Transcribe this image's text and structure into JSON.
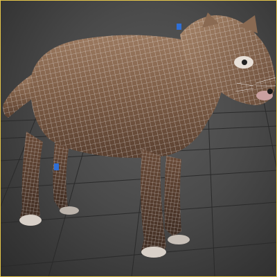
{
  "viewport": {
    "active_border_color": "#e8c84a",
    "background_color": "#4a4a4a",
    "grid_color": "#2a2a2a",
    "mesh": {
      "subject": "raccoon-dog",
      "surface_color": "#8a6a52",
      "wireframe_color": "#f0f0f0",
      "selection_marker_color": "#2f6fd6"
    }
  }
}
